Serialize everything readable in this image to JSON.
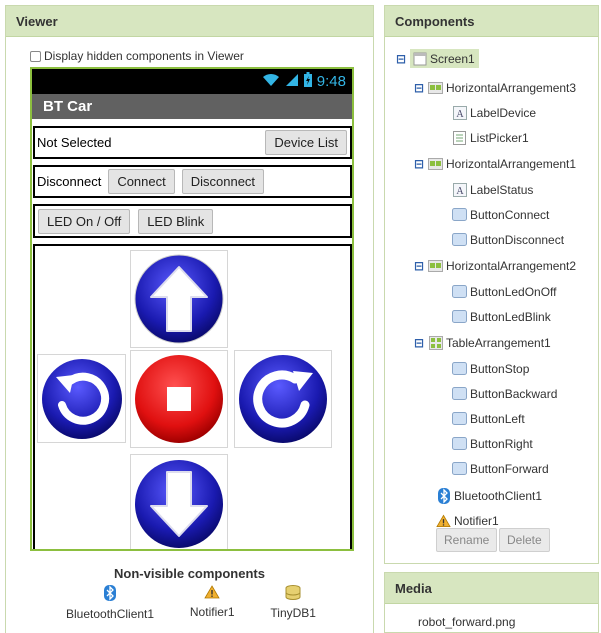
{
  "viewer": {
    "title": "Viewer",
    "show_hidden_label": "Display hidden components in Viewer",
    "phone": {
      "time": "9:48",
      "app_title": "BT Car",
      "row1": {
        "label": "Not Selected",
        "button": "Device List"
      },
      "row2": {
        "label": "Disconnect",
        "connect": "Connect",
        "disconnect": "Disconnect"
      },
      "row3": {
        "led_on_off": "LED On / Off",
        "led_blink": "LED Blink"
      }
    },
    "nonvisible": {
      "title": "Non-visible components",
      "items": [
        "BluetoothClient1",
        "Notifier1",
        "TinyDB1"
      ]
    }
  },
  "components": {
    "title": "Components",
    "tree": [
      {
        "label": "Screen1",
        "icon": "screen-icon"
      },
      {
        "label": "HorizontalArrangement3",
        "icon": "horizontal-arrangement-icon"
      },
      {
        "label": "LabelDevice",
        "icon": "label-icon"
      },
      {
        "label": "ListPicker1",
        "icon": "listpicker-icon"
      },
      {
        "label": "HorizontalArrangement1",
        "icon": "horizontal-arrangement-icon"
      },
      {
        "label": "LabelStatus",
        "icon": "label-icon"
      },
      {
        "label": "ButtonConnect",
        "icon": "button-icon"
      },
      {
        "label": "ButtonDisconnect",
        "icon": "button-icon"
      },
      {
        "label": "HorizontalArrangement2",
        "icon": "horizontal-arrangement-icon"
      },
      {
        "label": "ButtonLedOnOff",
        "icon": "button-icon"
      },
      {
        "label": "ButtonLedBlink",
        "icon": "button-icon"
      },
      {
        "label": "TableArrangement1",
        "icon": "table-arrangement-icon"
      },
      {
        "label": "ButtonStop",
        "icon": "button-icon"
      },
      {
        "label": "ButtonBackward",
        "icon": "button-icon"
      },
      {
        "label": "ButtonLeft",
        "icon": "button-icon"
      },
      {
        "label": "ButtonRight",
        "icon": "button-icon"
      },
      {
        "label": "ButtonForward",
        "icon": "button-icon"
      },
      {
        "label": "BluetoothClient1",
        "icon": "bluetooth-icon"
      },
      {
        "label": "Notifier1",
        "icon": "notifier-icon"
      }
    ],
    "rename_label": "Rename",
    "delete_label": "Delete"
  },
  "media": {
    "title": "Media",
    "items": [
      "robot_forward.png"
    ]
  },
  "colors": {
    "header_bg": "#d7e6c0",
    "phone_border": "#8cbf3f",
    "title_bar": "#616161",
    "status_accent": "#33b5e5",
    "arrow_blue": "#1a1aa8",
    "stop_red": "#e01010"
  }
}
